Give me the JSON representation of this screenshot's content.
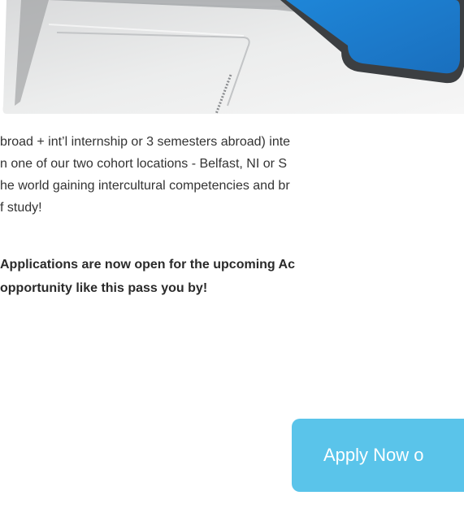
{
  "paragraph": {
    "lines": [
      "broad + int’l internship or 3 semesters abroad) inte",
      "n one of our two cohort locations - Belfast, NI or S",
      "he world gaining intercultural competencies and br",
      "f study!"
    ]
  },
  "announcement": {
    "lines": [
      "Applications are now open for the upcoming Ac",
      "opportunity like this pass you by!"
    ]
  },
  "cta": {
    "label": "Apply Now o",
    "color": "#5ac4ea"
  },
  "hero": {
    "screen_color": "#1e7fd0",
    "icon": "laptop-image"
  }
}
